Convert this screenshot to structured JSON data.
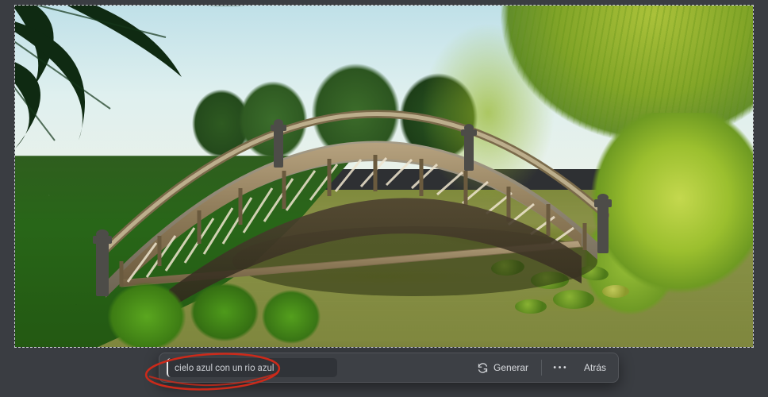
{
  "canvas": {
    "image_description": "Arched stone Japanese garden bridge over a green pond with trees and a weeping willow"
  },
  "toolbar": {
    "prompt_value": "cielo azul con un rio azul",
    "generate_label": "Generar",
    "more_label": "•••",
    "back_label": "Atrás"
  },
  "icons": {
    "generate": "generate-icon",
    "more": "more-icon"
  },
  "annotation": {
    "highlight": "prompt-field",
    "color": "#cc2a1a"
  }
}
